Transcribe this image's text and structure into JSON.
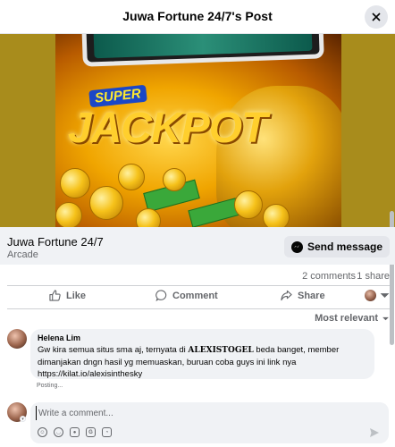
{
  "header": {
    "title": "Juwa Fortune 24/7's Post",
    "close_icon": "close-icon"
  },
  "media": {
    "super_text": "SUPER",
    "jackpot_text": "JACKPOT",
    "background_color": "#a88c1c"
  },
  "post": {
    "page_name": "Juwa Fortune 24/7",
    "category": "Arcade",
    "send_message_label": "Send message",
    "send_message_icon": "messenger-icon"
  },
  "stats": {
    "comments": "2 comments",
    "shares": "1 share"
  },
  "actions": {
    "like_label": "Like",
    "comment_label": "Comment",
    "share_label": "Share",
    "like_icon": "thumbs-up-icon",
    "comment_icon": "speech-bubble-icon",
    "share_icon": "share-arrow-icon"
  },
  "sort": {
    "label": "Most relevant"
  },
  "comments": [
    {
      "author": "Helena Lim",
      "text_before": "Gw kira semua situs sma aj, ternyata di ",
      "text_strong": "ALEXISTOGEL",
      "text_after": " beda banget, member dimanjakan dngn hasil yg memuaskan, buruan coba guys ini link nya https://kilat.io/alexisinthesky",
      "status": "Posting..."
    }
  ],
  "composer": {
    "placeholder": "Write a comment...",
    "tools": [
      "avatar-sticker-icon",
      "emoji-icon",
      "camera-icon",
      "gif-icon",
      "sticker-icon"
    ],
    "send_icon": "send-icon"
  },
  "colors": {
    "accent": "#1877f2",
    "secondary_text": "#65676b",
    "bubble_bg": "#f0f2f5"
  }
}
